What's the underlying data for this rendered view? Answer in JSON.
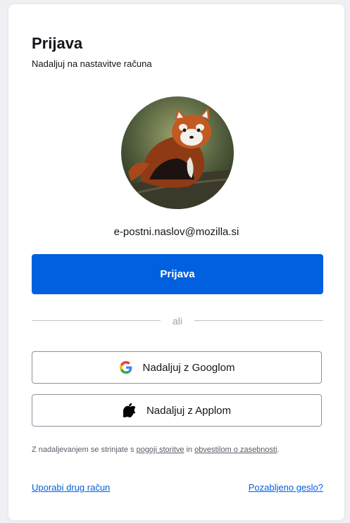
{
  "header": {
    "title": "Prijava",
    "subtitle": "Nadaljuj na nastavitve računa"
  },
  "account": {
    "avatar_icon": "red-panda-avatar",
    "email": "e-postni.naslov@mozilla.si"
  },
  "actions": {
    "sign_in_label": "Prijava",
    "divider_text": "ali",
    "google_label": "Nadaljuj z Googlom",
    "apple_label": "Nadaljuj z Applom"
  },
  "terms": {
    "prefix": "Z nadaljevanjem se strinjate s ",
    "terms_link": "pogoji storitve",
    "middle": " in ",
    "privacy_link": "obvestilom o zasebnosti",
    "suffix": "."
  },
  "footer": {
    "use_other_account": "Uporabi drug račun",
    "forgot_password": "Pozabljeno geslo?"
  },
  "colors": {
    "primary": "#0060df",
    "text": "#15141a",
    "muted": "#5b5b66"
  }
}
